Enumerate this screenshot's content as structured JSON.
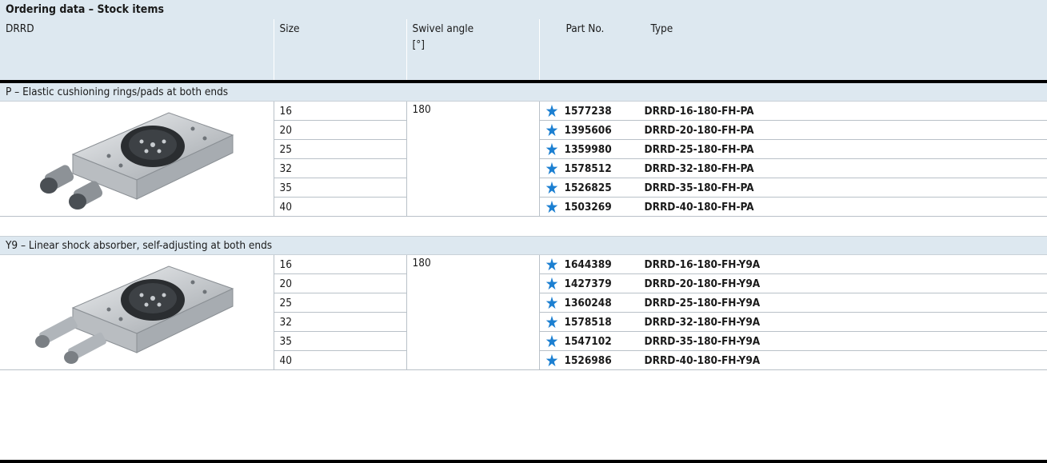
{
  "title": "Ordering data – Stock items",
  "headers": {
    "product": "DRRD",
    "size": "Size",
    "swivel_angle": "Swivel angle",
    "swivel_unit": "[°]",
    "part_no": "Part No.",
    "type": "Type"
  },
  "groups": [
    {
      "label": "P – Elastic cushioning rings/pads at both ends",
      "swivel_angle": "180",
      "image": "rotary-actuator-with-cushioning-pads",
      "items": [
        {
          "size": "16",
          "part_no": "1577238",
          "type": "DRRD-16-180-FH-PA"
        },
        {
          "size": "20",
          "part_no": "1395606",
          "type": "DRRD-20-180-FH-PA"
        },
        {
          "size": "25",
          "part_no": "1359980",
          "type": "DRRD-25-180-FH-PA"
        },
        {
          "size": "32",
          "part_no": "1578512",
          "type": "DRRD-32-180-FH-PA"
        },
        {
          "size": "35",
          "part_no": "1526825",
          "type": "DRRD-35-180-FH-PA"
        },
        {
          "size": "40",
          "part_no": "1503269",
          "type": "DRRD-40-180-FH-PA"
        }
      ]
    },
    {
      "label": "Y9 – Linear shock absorber, self-adjusting at both ends",
      "swivel_angle": "180",
      "image": "rotary-actuator-with-shock-absorbers",
      "items": [
        {
          "size": "16",
          "part_no": "1644389",
          "type": "DRRD-16-180-FH-Y9A"
        },
        {
          "size": "20",
          "part_no": "1427379",
          "type": "DRRD-20-180-FH-Y9A"
        },
        {
          "size": "25",
          "part_no": "1360248",
          "type": "DRRD-25-180-FH-Y9A"
        },
        {
          "size": "32",
          "part_no": "1578518",
          "type": "DRRD-32-180-FH-Y9A"
        },
        {
          "size": "35",
          "part_no": "1547102",
          "type": "DRRD-35-180-FH-Y9A"
        },
        {
          "size": "40",
          "part_no": "1526986",
          "type": "DRRD-40-180-FH-Y9A"
        }
      ]
    }
  ],
  "icons": {
    "stock_item": "star-icon"
  },
  "colors": {
    "header_bg": "#dde8f0",
    "star": "#1b7fd1",
    "rule": "#000000"
  }
}
